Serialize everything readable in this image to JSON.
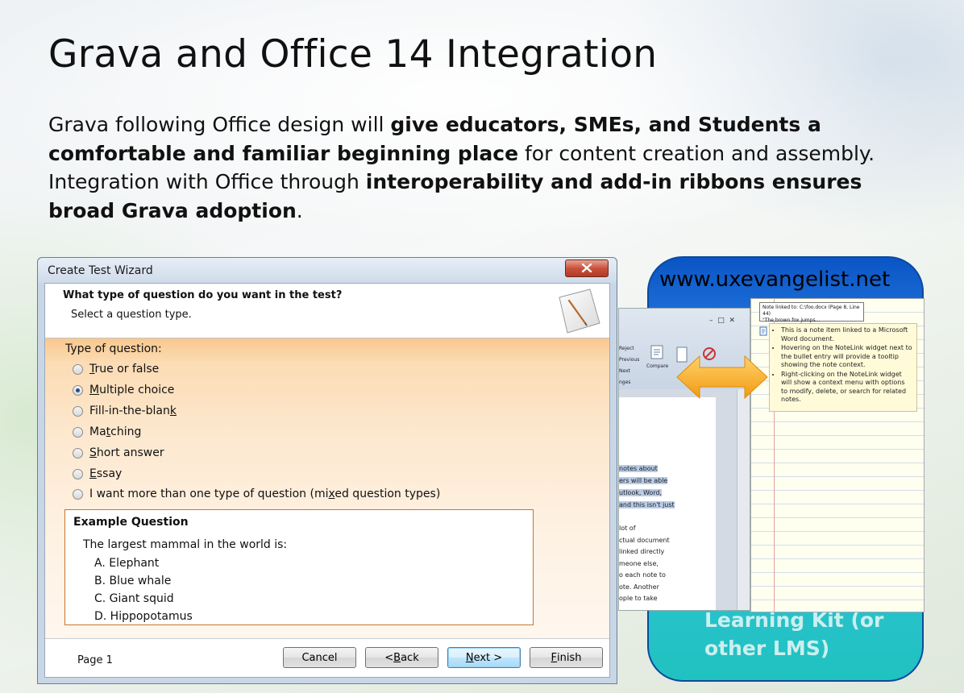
{
  "slide": {
    "title": "Grava and Office 14 Integration",
    "body": {
      "p1": "Grava following Office design will ",
      "b1": "give educators, SMEs, and Students a comfortable and familiar beginning place",
      "p2": " for content creation and assembly. Integration with Office through ",
      "b2": "interoperability and add-in ribbons ensures broad Grava adoption",
      "p3": "."
    }
  },
  "wizard": {
    "title": "Create Test Wizard",
    "question": "What type of question do you want in the test?",
    "subtitle": "Select a question type.",
    "type_label": "Type of question:",
    "options": [
      {
        "pre": "",
        "key": "T",
        "post": "rue or false",
        "checked": false
      },
      {
        "pre": "",
        "key": "M",
        "post": "ultiple choice",
        "checked": true
      },
      {
        "pre": "Fill-in-the-blan",
        "key": "k",
        "post": "",
        "checked": false
      },
      {
        "pre": "Ma",
        "key": "t",
        "post": "ching",
        "checked": false
      },
      {
        "pre": "",
        "key": "S",
        "post": "hort answer",
        "checked": false
      },
      {
        "pre": "",
        "key": "E",
        "post": "ssay",
        "checked": false
      },
      {
        "pre": "I want more than one type of question (mi",
        "key": "x",
        "post": "ed question types)",
        "checked": false
      }
    ],
    "example": {
      "title": "Example Question",
      "question": "The largest mammal in the world is:",
      "answers": [
        "A. Elephant",
        "B. Blue whale",
        "C. Giant squid",
        "D. Hippopotamus"
      ]
    },
    "footer": {
      "page": "Page 1",
      "cancel": "Cancel",
      "back_pre": "< ",
      "back_key": "B",
      "back_post": "ack",
      "next_key": "N",
      "next_post": "ext >",
      "finish_key": "F",
      "finish_post": "inish"
    }
  },
  "graphic": {
    "url": "www.uxevangelist.net",
    "caption_line1": "Learning Kit (or",
    "caption_line2": "other LMS)",
    "doc_ribbon": {
      "reject": "Reject",
      "previous": "Previous",
      "next": "Next",
      "compare": "Compare",
      "group": "nges"
    },
    "doc_text": [
      "notes about",
      "ers will be able",
      "utlook, Word,",
      "and this isn't just",
      "lot of",
      "ctual document",
      "linked directly",
      "meone else,",
      "o each note to",
      "ote. Another",
      "ople to take"
    ],
    "tooltip_line1": "Note linked to: C:\\foo.docx (Page 8, Line 44)",
    "tooltip_line2": "\"The brown fox jumps...",
    "note_items": [
      "This is a note item linked to a Microsoft Word document.",
      "Hovering on the NoteLink widget next to the bullet entry will provide a tooltip showing the note context.",
      "Right-clicking on the NoteLink widget will show a context menu with options to modify, delete, or search for related notes."
    ]
  },
  "colors": {
    "accent_orange": "#f5a623",
    "box_blue": "#0a55c5",
    "box_teal": "#20c2c0"
  }
}
